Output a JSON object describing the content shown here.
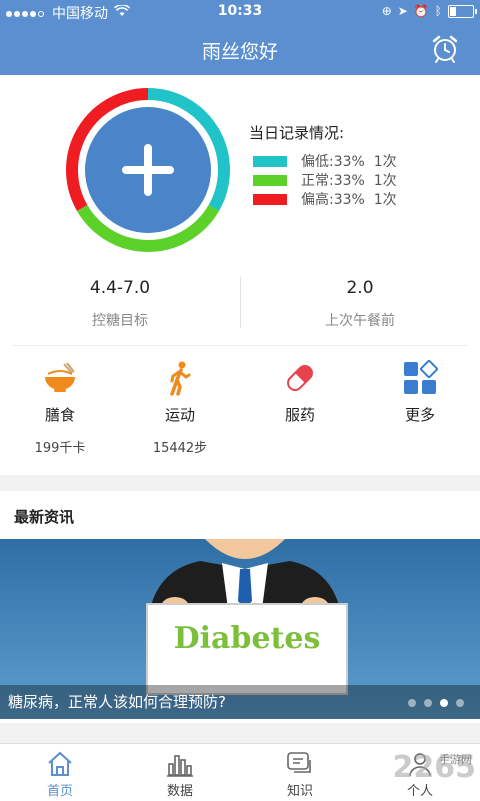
{
  "status": {
    "carrier": "中国移动",
    "time": "10:33"
  },
  "nav": {
    "title": "雨丝您好",
    "alarm_icon": "alarm-clock-icon"
  },
  "record": {
    "title": "当日记录情况:",
    "items": [
      {
        "label": "偏低:33%",
        "count": "1次",
        "color": "#1fc3c8"
      },
      {
        "label": "正常:33%",
        "count": "1次",
        "color": "#5bd12a"
      },
      {
        "label": "偏高:33%",
        "count": "1次",
        "color": "#ef1c22"
      }
    ],
    "add_icon": "plus-icon"
  },
  "stats": [
    {
      "value": "4.4-7.0",
      "label": "控糖目标"
    },
    {
      "value": "2.0",
      "label": "上次午餐前"
    }
  ],
  "quick": [
    {
      "label": "膳食",
      "sub": "199千卡",
      "icon": "bowl-icon"
    },
    {
      "label": "运动",
      "sub": "15442步",
      "icon": "walking-icon"
    },
    {
      "label": "服药",
      "sub": "",
      "icon": "pill-icon"
    },
    {
      "label": "更多",
      "sub": "",
      "icon": "grid-icon"
    }
  ],
  "news": {
    "heading": "最新资讯",
    "banner_text": "Diabetes",
    "caption": "糖尿病，正常人该如何合理预防?",
    "page_count": 4,
    "active_page": 3
  },
  "tabs": [
    {
      "label": "首页",
      "icon": "home-icon"
    },
    {
      "label": "数据",
      "icon": "bar-chart-icon"
    },
    {
      "label": "知识",
      "icon": "chat-icon"
    },
    {
      "label": "个人",
      "icon": "person-icon"
    }
  ],
  "watermark": {
    "number": "2265",
    "site": "手游网"
  },
  "colors": {
    "primary": "#5b8fd0",
    "low": "#1fc3c8",
    "normal": "#5bd12a",
    "high": "#ef1c22"
  }
}
